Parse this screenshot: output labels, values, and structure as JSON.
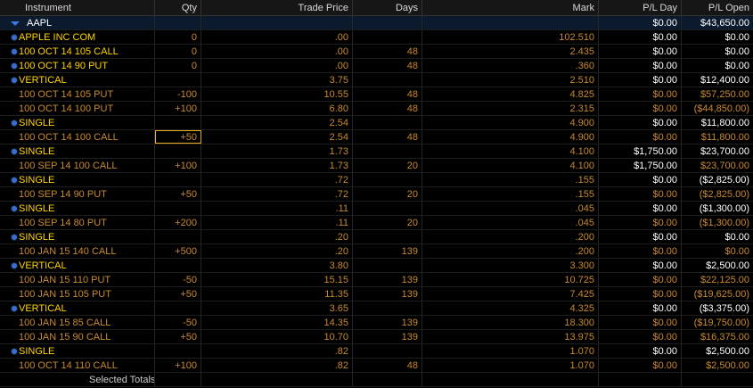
{
  "headers": {
    "instrument": "Instrument",
    "qty": "Qty",
    "trade_price": "Trade Price",
    "days": "Days",
    "mark": "Mark",
    "pl_day": "P/L Day",
    "pl_open": "P/L Open"
  },
  "symbol_row": {
    "symbol": "AAPL",
    "pl_day": "$0.00",
    "pl_open": "$43,650.00"
  },
  "rows": [
    {
      "kind": "group",
      "instrument": "APPLE INC COM",
      "qty": "0",
      "trade_price": ".00",
      "days": "",
      "mark": "102.510",
      "pl_day": "$0.00",
      "pl_open": "$0.00"
    },
    {
      "kind": "group",
      "instrument": "100 OCT 14 105 CALL",
      "qty": "0",
      "trade_price": ".00",
      "days": "48",
      "mark": "2.435",
      "pl_day": "$0.00",
      "pl_open": "$0.00"
    },
    {
      "kind": "group",
      "instrument": "100 OCT 14 90 PUT",
      "qty": "0",
      "trade_price": ".00",
      "days": "48",
      "mark": ".360",
      "pl_day": "$0.00",
      "pl_open": "$0.00"
    },
    {
      "kind": "group",
      "instrument": "VERTICAL",
      "qty": "",
      "trade_price": "3.75",
      "days": "",
      "mark": "2.510",
      "pl_day": "$0.00",
      "pl_open": "$12,400.00"
    },
    {
      "kind": "leg",
      "instrument": "100 OCT 14 105 PUT",
      "qty": "-100",
      "trade_price": "10.55",
      "days": "48",
      "mark": "4.825",
      "pl_day": "$0.00",
      "pl_open": "$57,250.00"
    },
    {
      "kind": "leg",
      "instrument": "100 OCT 14 100 PUT",
      "qty": "+100",
      "trade_price": "6.80",
      "days": "48",
      "mark": "2.315",
      "pl_day": "$0.00",
      "pl_open": "($44,850.00)"
    },
    {
      "kind": "group",
      "instrument": "SINGLE",
      "qty": "",
      "trade_price": "2.54",
      "days": "",
      "mark": "4.900",
      "pl_day": "$0.00",
      "pl_open": "$11,800.00"
    },
    {
      "kind": "leg",
      "instrument": "100 OCT 14 100 CALL",
      "qty": "+50",
      "trade_price": "2.54",
      "days": "48",
      "mark": "4.900",
      "pl_day": "$0.00",
      "pl_open": "$11,800.00",
      "selected": true
    },
    {
      "kind": "group",
      "instrument": "SINGLE",
      "qty": "",
      "trade_price": "1.73",
      "days": "",
      "mark": "4.100",
      "pl_day": "$1,750.00",
      "pl_open": "$23,700.00"
    },
    {
      "kind": "leg",
      "instrument": "100 SEP 14 100 CALL",
      "qty": "+100",
      "trade_price": "1.73",
      "days": "20",
      "mark": "4.100",
      "pl_day": "$1,750.00",
      "pl_open": "$23,700.00"
    },
    {
      "kind": "group",
      "instrument": "SINGLE",
      "qty": "",
      "trade_price": ".72",
      "days": "",
      "mark": ".155",
      "pl_day": "$0.00",
      "pl_open": "($2,825.00)"
    },
    {
      "kind": "leg",
      "instrument": "100 SEP 14 90 PUT",
      "qty": "+50",
      "trade_price": ".72",
      "days": "20",
      "mark": ".155",
      "pl_day": "$0.00",
      "pl_open": "($2,825.00)"
    },
    {
      "kind": "group",
      "instrument": "SINGLE",
      "qty": "",
      "trade_price": ".11",
      "days": "",
      "mark": ".045",
      "pl_day": "$0.00",
      "pl_open": "($1,300.00)"
    },
    {
      "kind": "leg",
      "instrument": "100 SEP 14 80 PUT",
      "qty": "+200",
      "trade_price": ".11",
      "days": "20",
      "mark": ".045",
      "pl_day": "$0.00",
      "pl_open": "($1,300.00)"
    },
    {
      "kind": "group",
      "instrument": "SINGLE",
      "qty": "",
      "trade_price": ".20",
      "days": "",
      "mark": ".200",
      "pl_day": "$0.00",
      "pl_open": "$0.00"
    },
    {
      "kind": "leg",
      "instrument": "100 JAN 15 140 CALL",
      "qty": "+500",
      "trade_price": ".20",
      "days": "139",
      "mark": ".200",
      "pl_day": "$0.00",
      "pl_open": "$0.00"
    },
    {
      "kind": "group",
      "instrument": "VERTICAL",
      "qty": "",
      "trade_price": "3.80",
      "days": "",
      "mark": "3.300",
      "pl_day": "$0.00",
      "pl_open": "$2,500.00"
    },
    {
      "kind": "leg",
      "instrument": "100 JAN 15 110 PUT",
      "qty": "-50",
      "trade_price": "15.15",
      "days": "139",
      "mark": "10.725",
      "pl_day": "$0.00",
      "pl_open": "$22,125.00"
    },
    {
      "kind": "leg",
      "instrument": "100 JAN 15 105 PUT",
      "qty": "+50",
      "trade_price": "11.35",
      "days": "139",
      "mark": "7.425",
      "pl_day": "$0.00",
      "pl_open": "($19,625.00)"
    },
    {
      "kind": "group",
      "instrument": "VERTICAL",
      "qty": "",
      "trade_price": "3.65",
      "days": "",
      "mark": "4.325",
      "pl_day": "$0.00",
      "pl_open": "($3,375.00)"
    },
    {
      "kind": "leg",
      "instrument": "100 JAN 15 85 CALL",
      "qty": "-50",
      "trade_price": "14.35",
      "days": "139",
      "mark": "18.300",
      "pl_day": "$0.00",
      "pl_open": "($19,750.00)"
    },
    {
      "kind": "leg",
      "instrument": "100 JAN 15 90 CALL",
      "qty": "+50",
      "trade_price": "10.70",
      "days": "139",
      "mark": "13.975",
      "pl_day": "$0.00",
      "pl_open": "$16,375.00"
    },
    {
      "kind": "group",
      "instrument": "SINGLE",
      "qty": "",
      "trade_price": ".82",
      "days": "",
      "mark": "1.070",
      "pl_day": "$0.00",
      "pl_open": "$2,500.00"
    },
    {
      "kind": "leg",
      "instrument": "100 OCT 14 110 CALL",
      "qty": "+100",
      "trade_price": ".82",
      "days": "48",
      "mark": "1.070",
      "pl_day": "$0.00",
      "pl_open": "$2,500.00"
    }
  ],
  "footer": {
    "label": "Selected Totals"
  },
  "colors": {
    "group_text": "#ffd400",
    "leg_text": "#c88a2c",
    "bullet": "#3a6fd0",
    "symbol_bg": "#0c1a2e"
  }
}
